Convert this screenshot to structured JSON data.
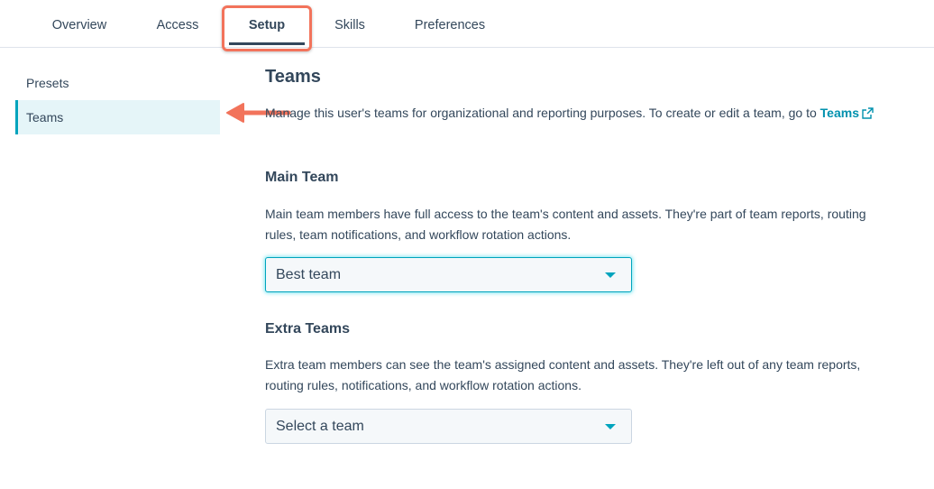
{
  "tabs": [
    {
      "label": "Overview"
    },
    {
      "label": "Access"
    },
    {
      "label": "Setup",
      "active": true
    },
    {
      "label": "Skills"
    },
    {
      "label": "Preferences"
    }
  ],
  "sidebar": {
    "items": [
      {
        "label": "Presets"
      },
      {
        "label": "Teams",
        "active": true
      }
    ]
  },
  "main": {
    "title": "Teams",
    "description_prefix": "Manage this user's teams for organizational and reporting purposes. To create or edit a team, go to ",
    "description_link": "Teams",
    "main_team": {
      "title": "Main Team",
      "description": "Main team members have full access to the team's content and assets. They're part of team reports, routing rules, team notifications, and workflow rotation actions.",
      "selected": "Best team"
    },
    "extra_teams": {
      "title": "Extra Teams",
      "description": "Extra team members can see the team's assigned content and assets. They're left out of any team reports, routing rules, notifications, and workflow rotation actions.",
      "placeholder": "Select a team"
    }
  },
  "colors": {
    "accent": "#00a4bd",
    "link": "#0091ae",
    "annotation": "#f2735b",
    "text": "#33475b",
    "sidebar_active_bg": "#e5f5f8"
  },
  "icons": {
    "external_link": "external-link-icon",
    "dropdown_caret": "caret-down-icon",
    "annotation_arrow": "arrow-left-icon"
  }
}
